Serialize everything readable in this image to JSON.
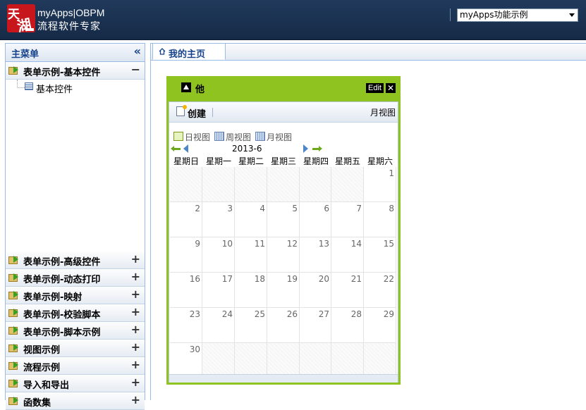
{
  "header": {
    "logo_text": "天湖",
    "brand_line1": "myApps|OBPM",
    "brand_line2": "流程软件专家",
    "app_select": "myApps功能示例"
  },
  "sidebar": {
    "title": "主菜单",
    "collapse_icon": "double-chevron-left-icon",
    "expanded": {
      "label": "表单示例-基本控件",
      "toggle": "−",
      "children": [
        {
          "label": "基本控件"
        }
      ]
    },
    "items": [
      {
        "label": "表单示例-高级控件",
        "toggle": "+"
      },
      {
        "label": "表单示例-动态打印",
        "toggle": "+"
      },
      {
        "label": "表单示例-映射",
        "toggle": "+"
      },
      {
        "label": "表单示例-校验脚本",
        "toggle": "+"
      },
      {
        "label": "表单示例-脚本示例",
        "toggle": "+"
      },
      {
        "label": "视图示例",
        "toggle": "+"
      },
      {
        "label": "流程示例",
        "toggle": "+"
      },
      {
        "label": "导入和导出",
        "toggle": "+"
      },
      {
        "label": "函数集",
        "toggle": "+"
      }
    ]
  },
  "tabs": [
    {
      "label": "我的主页",
      "icon": "home-icon",
      "active": true
    }
  ],
  "widget": {
    "title": "他",
    "edit_label": "Edit",
    "close_label": "✕",
    "toolbar": {
      "create_label": "创建",
      "view_label": "月视图"
    },
    "view_buttons": [
      {
        "label": "日视图",
        "icon": "day-view-icon"
      },
      {
        "label": "周视图",
        "icon": "week-view-icon"
      },
      {
        "label": "月视图",
        "icon": "month-view-icon"
      }
    ],
    "calendar": {
      "month_label": "2013-6",
      "weekdays": [
        "星期日",
        "星期一",
        "星期二",
        "星期三",
        "星期四",
        "星期五",
        "星期六"
      ],
      "weeks": [
        [
          "",
          "",
          "",
          "",
          "",
          "",
          "1"
        ],
        [
          "2",
          "3",
          "4",
          "5",
          "6",
          "7",
          "8"
        ],
        [
          "9",
          "10",
          "11",
          "12",
          "13",
          "14",
          "15"
        ],
        [
          "16",
          "17",
          "18",
          "19",
          "20",
          "21",
          "22"
        ],
        [
          "23",
          "24",
          "25",
          "26",
          "27",
          "28",
          "29"
        ],
        [
          "30",
          "",
          "",
          "",
          "",
          "",
          ""
        ]
      ]
    }
  },
  "colors": {
    "header_bg": "#1b3252",
    "widget_frame": "#8fc31f",
    "panel_border": "#99bbe8",
    "title_text": "#15428b"
  }
}
